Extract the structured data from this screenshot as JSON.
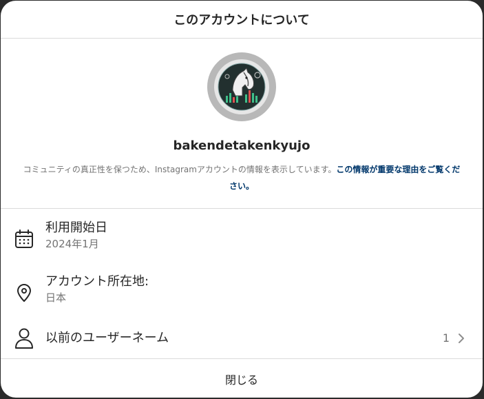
{
  "modal": {
    "title": "このアカウントについて",
    "username": "bakendetakenkyujo",
    "description": "コミュニティの真正性を保つため、Instagramアカウントの情報を表示しています。",
    "description_link": "この情報が重要な理由をご覧ください。"
  },
  "info": {
    "date_joined_label": "利用開始日",
    "date_joined_value": "2024年1月",
    "location_label": "アカウント所在地:",
    "location_value": "日本",
    "former_usernames_label": "以前のユーザーネーム",
    "former_usernames_count": "1"
  },
  "footer": {
    "close_label": "閉じる"
  },
  "icons": {
    "calendar": "calendar-icon",
    "location": "location-pin-icon",
    "person": "person-icon",
    "chevron": "chevron-right-icon"
  },
  "colors": {
    "link": "#00376b",
    "text": "#262626",
    "secondary": "#737373",
    "divider": "#dbdbdb"
  }
}
